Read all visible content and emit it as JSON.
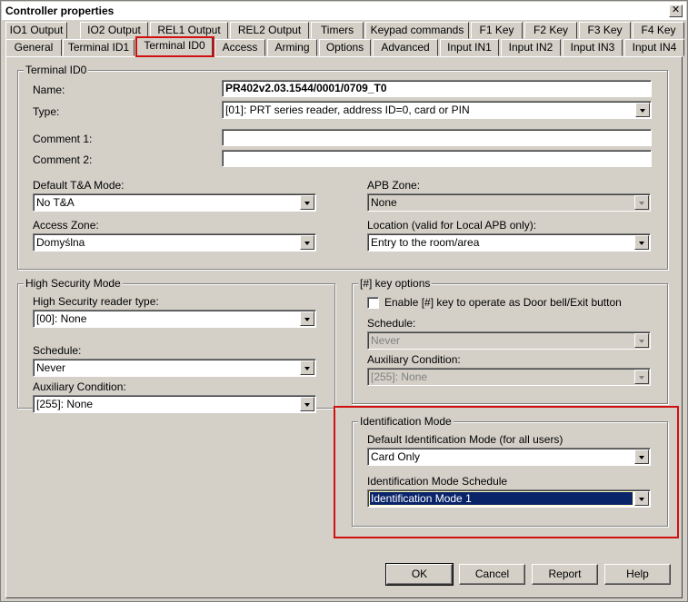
{
  "window": {
    "title": "Controller properties",
    "close_glyph": "✕"
  },
  "tabs_row1": [
    "IO1 Output",
    "IO2 Output",
    "REL1 Output",
    "REL2 Output",
    "Timers",
    "Keypad commands",
    "F1 Key",
    "F2 Key",
    "F3 Key",
    "F4 Key"
  ],
  "tabs_row2": [
    "General",
    "Terminal ID1",
    "Terminal ID0",
    "Access",
    "Arming",
    "Options",
    "Advanced",
    "Input IN1",
    "Input IN2",
    "Input IN3",
    "Input IN4"
  ],
  "active_tab": "Terminal ID0",
  "terminal": {
    "group_title": "Terminal ID0",
    "name_label": "Name:",
    "name_value": "PR402v2.03.1544/0001/0709_T0",
    "type_label": "Type:",
    "type_value": "[01]: PRT series reader, address ID=0, card or PIN",
    "comment1_label": "Comment 1:",
    "comment1_value": "",
    "comment2_label": "Comment 2:",
    "comment2_value": "",
    "ta_mode_label": "Default T&A Mode:",
    "ta_mode_value": "No T&A",
    "apb_zone_label": "APB Zone:",
    "apb_zone_value": "None",
    "access_zone_label": "Access Zone:",
    "access_zone_value": "Domyślna",
    "location_label": "Location (valid for Local APB only):",
    "location_value": "Entry to the room/area"
  },
  "high_security": {
    "group_title": "High Security Mode",
    "reader_type_label": "High Security reader type:",
    "reader_type_value": "[00]: None",
    "schedule_label": "Schedule:",
    "schedule_value": "Never",
    "aux_label": "Auxiliary Condition:",
    "aux_value": "[255]: None"
  },
  "key_options": {
    "group_title": "[#] key options",
    "enable_label": "Enable [#] key to operate as Door bell/Exit button",
    "enable_checked": false,
    "schedule_label": "Schedule:",
    "schedule_value": "Never",
    "aux_label": "Auxiliary Condition:",
    "aux_value": "[255]: None"
  },
  "identification": {
    "group_title": "Identification Mode",
    "default_label": "Default Identification Mode (for all users)",
    "default_value": "Card Only",
    "schedule_label": "Identification Mode Schedule",
    "schedule_value": "Identification Mode 1"
  },
  "buttons": {
    "ok": "OK",
    "cancel": "Cancel",
    "report": "Report",
    "help": "Help"
  },
  "colors": {
    "highlight_red": "#d01010",
    "selection_blue": "#0a246a",
    "face": "#d4d0c8"
  }
}
